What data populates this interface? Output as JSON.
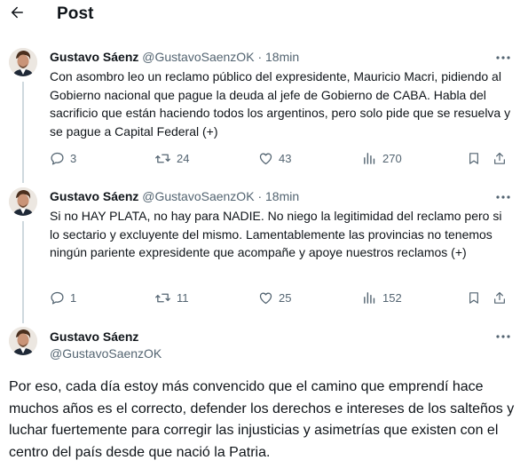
{
  "header": {
    "back_icon": "arrow-left-icon",
    "title": "Post"
  },
  "tweets": [
    {
      "author_name": "Gustavo Sáenz",
      "handle": "@GustavoSaenzOK",
      "separator": "·",
      "time": "18min",
      "text": "Con asombro leo un reclamo público del expresidente, Mauricio Macri, pidiendo al Gobierno nacional que pague la deuda al jefe de Gobierno de CABA. Habla del sacrificio que están haciendo todos los argentinos, pero solo pide que se resuelva y se pague a Capital Federal (+)",
      "replies": "3",
      "reposts": "24",
      "likes": "43",
      "views": "270"
    },
    {
      "author_name": "Gustavo Sáenz",
      "handle": "@GustavoSaenzOK",
      "separator": "·",
      "time": "18min",
      "text": "Si no HAY PLATA, no hay para NADIE. No niego la legitimidad del reclamo pero si lo sectario y excluyente del mismo. Lamentablemente las provincias no tenemos ningún pariente expresidente que acompañe y apoye nuestros reclamos (+)",
      "replies": "1",
      "reposts": "11",
      "likes": "25",
      "views": "152"
    }
  ],
  "main_tweet": {
    "author_name": "Gustavo Sáenz",
    "handle": "@GustavoSaenzOK",
    "text": "Por eso, cada día estoy más convencido que el camino que emprendí hace muchos años es el correcto, defender los derechos e intereses de los salteños y luchar fuertemente para corregir las injusticias y asimetrías que existen con el centro del país desde que nació la Patria."
  },
  "colors": {
    "text": "#0f1419",
    "secondary": "#536471",
    "thread_line": "#cfd9de"
  },
  "icons": [
    "arrow-left-icon",
    "more-icon",
    "reply-icon",
    "repost-icon",
    "like-icon",
    "views-icon",
    "bookmark-icon",
    "share-icon"
  ]
}
